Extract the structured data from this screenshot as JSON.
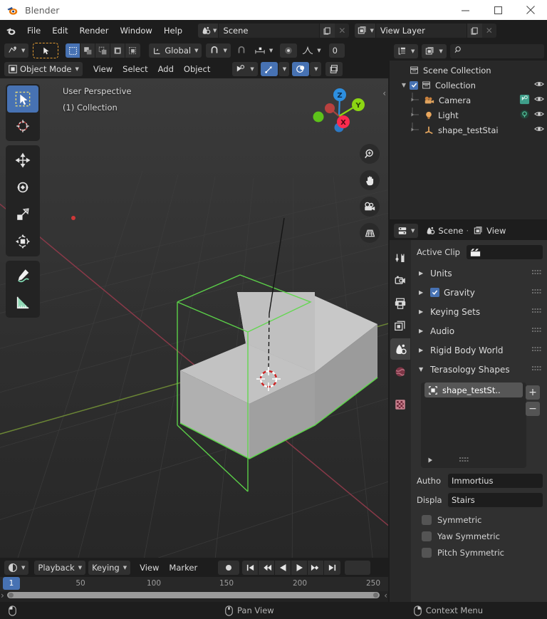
{
  "window": {
    "title": "Blender",
    "controls": {
      "minimize": "minimize-icon",
      "maximize": "maximize-icon",
      "close": "close-icon"
    }
  },
  "topbar": {
    "logo": "blender-logo-icon",
    "menus": [
      "File",
      "Edit",
      "Render",
      "Window",
      "Help"
    ],
    "scene_block": {
      "icon": "scene-icon",
      "name": "Scene",
      "copy": "new-scene-icon",
      "unlink": "✕"
    },
    "viewlayer_block": {
      "icon": "view-layer-icon",
      "name": "View Layer",
      "copy": "new-view-layer-icon",
      "unlink": "✕"
    }
  },
  "viewport": {
    "header_row1": {
      "editor_type_icon": "editor-type-3d-viewport-icon",
      "select_tool_icon": "tweak-select-icon",
      "select_modes": [
        "select-box-icon",
        "select-box-extend-icon",
        "select-box-subtract-icon",
        "select-box-invert-icon",
        "select-box-intersect-icon"
      ],
      "transform_orientation": "Global",
      "snap_icon": "magnet-icon",
      "proportional_icon": "proportional-edit-icon",
      "falloff_icon": "smooth-falloff-icon",
      "cut_field": "0"
    },
    "header_row2": {
      "mode_icon": "object-mode-icon",
      "mode": "Object Mode",
      "menus": [
        "View",
        "Select",
        "Add",
        "Object"
      ],
      "visibility_icon": "object-types-visibility-icon",
      "gizmo_icon": "gizmo-icon",
      "overlays_icon": "overlays-icon",
      "xray_icon": "toggle-xray-icon"
    },
    "overlay_text": {
      "perspective": "User Perspective",
      "collection": "(1) Collection"
    },
    "gizmo": {
      "axes": [
        "Z",
        "Y",
        "X"
      ],
      "colors": {
        "x": "#fc2b4e",
        "y": "#8cd613",
        "z": "#2d8fe0"
      }
    },
    "nav_buttons": [
      "zoom-icon",
      "hand-move-icon",
      "camera-view-icon",
      "toggle-perspective-icon"
    ],
    "tools": [
      {
        "name": "tweak-tool",
        "icon": "cursor-arrow-icon",
        "active": true
      },
      {
        "name": "cursor-tool",
        "icon": "3d-cursor-icon",
        "active": false
      },
      {
        "name": "move-tool",
        "icon": "move-arrows-icon",
        "active": false
      },
      {
        "name": "rotate-tool",
        "icon": "rotate-icon",
        "active": false
      },
      {
        "name": "scale-tool",
        "icon": "scale-icon",
        "active": false
      },
      {
        "name": "transform-tool",
        "icon": "transform-icon",
        "active": false
      },
      {
        "name": "annotate-tool",
        "icon": "pencil-annotate-icon",
        "active": false
      },
      {
        "name": "measure-tool",
        "icon": "ruler-measure-icon",
        "active": false
      }
    ],
    "object": {
      "name": "shape_testStairs",
      "type": "stairs-mesh",
      "selected": true
    }
  },
  "timeline": {
    "editor_icon": "editor-type-timeline-icon",
    "menus": [
      "Playback",
      "Keying",
      "View",
      "Marker"
    ],
    "record_icon": "auto-keying-record-icon",
    "transport": [
      "jump-to-start-icon",
      "jump-to-prev-keyframe-icon",
      "play-reverse-icon",
      "play-icon",
      "jump-to-next-keyframe-icon",
      "jump-to-end-icon"
    ],
    "current_frame": "1",
    "ticks": [
      "50",
      "100",
      "150",
      "200",
      "250"
    ],
    "tick_positions": [
      50,
      100,
      150,
      200,
      250
    ],
    "frame_range": [
      1,
      270
    ]
  },
  "outliner": {
    "display_mode_icon": "outliner-display-mode-icon",
    "filter_icon": "outliner-filter-icon",
    "search_icon": "search-icon",
    "search_placeholder": "",
    "rows": [
      {
        "label": "Scene Collection",
        "icon": "collection-icon",
        "indent": 0,
        "disclosure": "",
        "checkbox": false,
        "eye": false,
        "extra": ""
      },
      {
        "label": "Collection",
        "icon": "collection-icon",
        "indent": 1,
        "disclosure": "▼",
        "checkbox": true,
        "eye": true,
        "extra": ""
      },
      {
        "label": "Camera",
        "icon": "camera-icon",
        "indent": 2,
        "disclosure": "",
        "checkbox": false,
        "eye": true,
        "extra": "camera-data-icon"
      },
      {
        "label": "Light",
        "icon": "light-icon",
        "indent": 2,
        "disclosure": "",
        "checkbox": false,
        "eye": true,
        "extra": "light-data-icon"
      },
      {
        "label": "shape_testStai",
        "icon": "empty-axes-icon",
        "indent": 2,
        "disclosure": "",
        "checkbox": false,
        "eye": true,
        "extra": ""
      }
    ]
  },
  "properties": {
    "header": {
      "editor_icon": "editor-type-properties-icon",
      "breadcrumb_scene_icon": "scene-icon",
      "breadcrumb_scene": "Scene",
      "breadcrumb_sep": "·",
      "breadcrumb_layer_icon": "view-layer-icon",
      "breadcrumb_layer": "View"
    },
    "tabs": [
      {
        "name": "tool-tab",
        "icon": "tool-icon",
        "active": false
      },
      {
        "name": "render-tab",
        "icon": "render-camera-back-icon",
        "active": false
      },
      {
        "name": "output-tab",
        "icon": "printer-output-icon",
        "active": false
      },
      {
        "name": "view-layer-tab",
        "icon": "images-view-layer-icon",
        "active": false
      },
      {
        "name": "scene-tab",
        "icon": "scene-properties-icon",
        "active": true
      },
      {
        "name": "world-tab",
        "icon": "world-globe-icon",
        "active": false
      },
      {
        "name": "texture-tab",
        "icon": "checker-texture-icon",
        "active": false
      }
    ],
    "active_clip": {
      "label": "Active Clip",
      "icon": "movie-clip-icon",
      "value": ""
    },
    "panels": [
      {
        "label": "Units",
        "open": false,
        "checkbox": null
      },
      {
        "label": "Gravity",
        "open": false,
        "checkbox": true
      },
      {
        "label": "Keying Sets",
        "open": false,
        "checkbox": null
      },
      {
        "label": "Audio",
        "open": false,
        "checkbox": null
      },
      {
        "label": "Rigid Body World",
        "open": false,
        "checkbox": null
      },
      {
        "label": "Terasology Shapes",
        "open": true,
        "checkbox": null
      }
    ],
    "shape_list": {
      "items": [
        {
          "label": "shape_testSt..",
          "icon": "mesh-shape-icon",
          "selected": true
        }
      ],
      "add_label": "+",
      "remove_label": "−",
      "expand_icon": "play-triangle-icon",
      "grip_icon": "grip-dots-icon"
    },
    "fields": [
      {
        "label": "Autho",
        "full_label": "Author",
        "value": "Immortius",
        "name": "author-field"
      },
      {
        "label": "Displa",
        "full_label": "Display Name",
        "value": "Stairs",
        "name": "display-name-field"
      }
    ],
    "checkboxes": [
      {
        "label": "Symmetric",
        "checked": false
      },
      {
        "label": "Yaw Symmetric",
        "checked": false
      },
      {
        "label": "Pitch Symmetric",
        "checked": false
      }
    ]
  },
  "statusbar": {
    "left_icon": "mouse-left-button-icon",
    "items": [
      {
        "icon": "mouse-middle-button-icon",
        "label": "Pan View"
      },
      {
        "icon": "mouse-right-button-icon",
        "label": "Context Menu"
      }
    ]
  },
  "colors": {
    "accent_blue": "#4772b3",
    "window_bg": "#1d1d1d",
    "editor_bg": "#303030",
    "panel_bg": "#282828",
    "axis_x": "#fc2b4e",
    "axis_y": "#8cd613",
    "axis_z": "#2d8fe0",
    "selection_outline": "#6fe05a"
  }
}
